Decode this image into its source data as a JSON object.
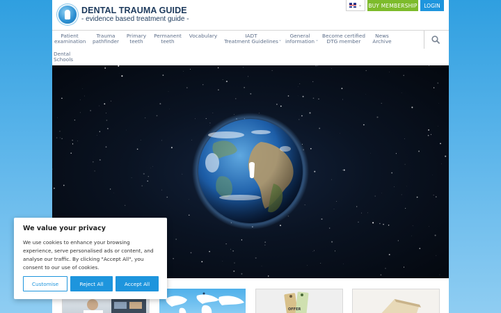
{
  "header": {
    "logo_title": "DENTAL TRAUMA GUIDE",
    "logo_subtitle": "- evidence based treatment guide -",
    "language": "EN",
    "buy_membership": "BUY MEMBERSHIP",
    "login": "LOGIN"
  },
  "nav": {
    "items": [
      {
        "label": "Patient\nexamination"
      },
      {
        "label": "Trauma\npathfinder"
      },
      {
        "label": "Primary\nteeth"
      },
      {
        "label": "Permanent\nteeth"
      },
      {
        "label": "Vocabulary"
      },
      {
        "label": "IADT\nTreatment Guidelines",
        "dropdown": true
      },
      {
        "label": "General\ninformation",
        "dropdown": true
      },
      {
        "label": "Become certified\nDTG member"
      },
      {
        "label": "News\nArchive"
      },
      {
        "label": "Dental\nSchools"
      }
    ]
  },
  "cards": {
    "offer_tag": "OFFER"
  },
  "cookie": {
    "title": "We value your privacy",
    "text": "We use cookies to enhance your browsing experience, serve personalised ads or content, and analyse our traffic. By clicking \"Accept All\", you consent to our use of cookies.",
    "customise": "Customise",
    "reject": "Reject All",
    "accept": "Accept All"
  },
  "colors": {
    "brand_blue": "#1e95dd",
    "membership_green": "#7dbb2b",
    "nav_text": "#5e6f8a",
    "logo_navy": "#1d3a5c"
  },
  "icons": {
    "search": "search-icon",
    "chevron": "chevron-down-icon",
    "flag": "uk-flag-icon"
  }
}
